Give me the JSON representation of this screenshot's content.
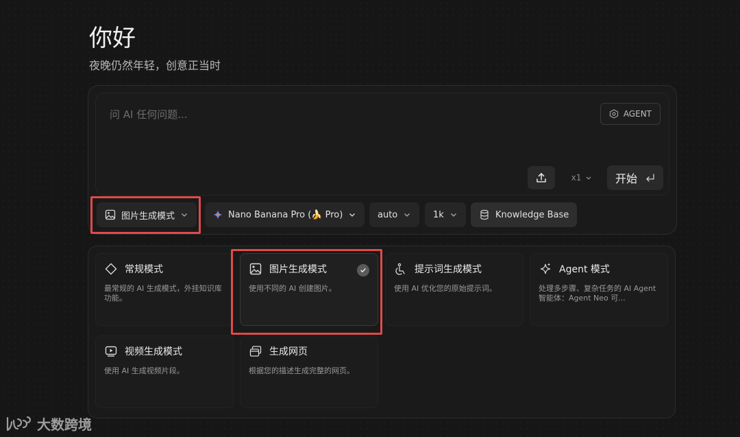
{
  "header": {
    "title": "你好",
    "subtitle": "夜晚仍然年轻，创意正当时"
  },
  "composer": {
    "placeholder": "问 AI 任何问题...",
    "agent_label": "AGENT",
    "multiplier": "x1",
    "start_label": "开始"
  },
  "toolbar": {
    "mode_label": "图片生成模式",
    "model_label": "Nano Banana Pro (🍌 Pro)",
    "aspect_label": "auto",
    "resolution_label": "1k",
    "kb_label": "Knowledge Base"
  },
  "modes": [
    {
      "title": "常规模式",
      "desc": "最常规的 AI 生成模式，外挂知识库功能。",
      "icon": "diamond-icon",
      "selected": false
    },
    {
      "title": "图片生成模式",
      "desc": "使用不同的 AI 创建图片。",
      "icon": "image-icon",
      "selected": true
    },
    {
      "title": "提示词生成模式",
      "desc": "使用 AI 优化您的原始提示词。",
      "icon": "prompt-icon",
      "selected": false
    },
    {
      "title": "Agent 模式",
      "desc": "处理多步骤、复杂任务的 AI Agent 智能体：Agent Neo 可...",
      "icon": "sparkle-icon",
      "selected": false
    },
    {
      "title": "视频生成模式",
      "desc": "使用 AI 生成视频片段。",
      "icon": "video-icon",
      "selected": false
    },
    {
      "title": "生成网页",
      "desc": "根据您的描述生成完整的网页。",
      "icon": "webpage-icon",
      "selected": false
    }
  ],
  "watermark": {
    "text": "大数跨境",
    "logo": "lbc"
  },
  "colors": {
    "background": "#161616",
    "highlight": "#e14a4a"
  }
}
